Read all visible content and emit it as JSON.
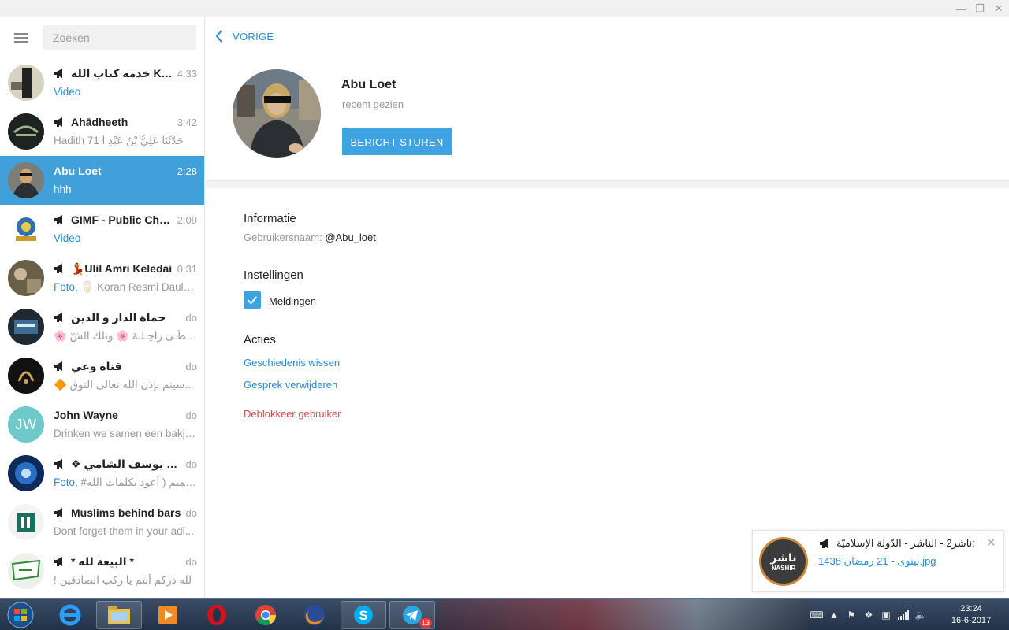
{
  "window": {
    "min": "—",
    "max": "❐",
    "close": "✕"
  },
  "sidebar": {
    "search_placeholder": "Zoeken",
    "chats": [
      {
        "name": "خدمة كتاب الله Koran...",
        "time": "4:33",
        "msg_prefix": "Video",
        "msg": "",
        "channel": true,
        "avatar": "koran"
      },
      {
        "name": "Ahādheeth",
        "time": "3:42",
        "msg_prefix": "",
        "msg": "Hadith 71 حَدَّثَنَا عَلِيُّ بْنُ عَبْدِ ا",
        "channel": true,
        "avatar": "ahadheeth"
      },
      {
        "name": "Abu Loet",
        "time": "2:28",
        "msg_prefix": "",
        "msg": "hhh",
        "channel": false,
        "avatar": "abuloet",
        "active": true
      },
      {
        "name": "GIMF - Public Chan...",
        "time": "2:09",
        "msg_prefix": "Video",
        "msg": "",
        "channel": true,
        "avatar": "gimf"
      },
      {
        "name": "💃Ulil Amri Keledai",
        "time": "0:31",
        "msg_prefix": "Foto,",
        "msg": " 🥛 Koran Resmi Daula...",
        "channel": true,
        "avatar": "ulil"
      },
      {
        "name": "حماة الدار و الدين",
        "time": "do",
        "msg_prefix": "",
        "msg": "🌸 خِـطّـى رَاحِـلـهٔ 🌸 وتلك الشّ...",
        "channel": true,
        "avatar": "himat"
      },
      {
        "name": "قناة وعي",
        "time": "do",
        "msg_prefix": "",
        "msg": "🔶 سيتم بإذن الله تعالى التوق...",
        "channel": true,
        "avatar": "waay"
      },
      {
        "name": "John Wayne",
        "time": "do",
        "msg_prefix": "",
        "msg": "Drinken we samen een bakje ...",
        "channel": false,
        "avatar": "jw",
        "initials": "JW"
      },
      {
        "name": "❖ أبو يوسف الشامي ❖",
        "time": "do",
        "msg_prefix": "Foto,",
        "msg": " #تصميم ( أعوذ بكلمات الله...",
        "channel": true,
        "avatar": "abuyusuf"
      },
      {
        "name": "Muslims behind bars",
        "time": "do",
        "msg_prefix": "",
        "msg": "Dont forget them in your adi...",
        "channel": true,
        "avatar": "muslims"
      },
      {
        "name": "* البيعة لله *",
        "time": "do",
        "msg_prefix": "",
        "msg": "! لله دركم أنتم يا ركب الصادقين",
        "channel": true,
        "avatar": "bayah"
      }
    ]
  },
  "main": {
    "back_label": "VORIGE",
    "profile": {
      "name": "Abu Loet",
      "status": "recent gezien",
      "send_button": "BERICHT STUREN"
    },
    "info": {
      "title": "Informatie",
      "username_label": "Gebruikersnaam:",
      "username_value": "@Abu_loet"
    },
    "settings": {
      "title": "Instellingen",
      "notifications_label": "Meldingen",
      "notifications_checked": true
    },
    "actions": {
      "title": "Acties",
      "clear_history": "Geschiedenis wissen",
      "delete_chat": "Gesprek verwijderen",
      "unblock_user": "Deblokkeer gebruiker"
    }
  },
  "notification": {
    "title": "ناشر2 - الناشر - الدّولة الإسلاميّة:",
    "body": "نينوى - 21 رمضان 1438.jpg",
    "avatar_text_ar": "ناشر",
    "avatar_text_en": "NASHIR",
    "close": "✕"
  },
  "taskbar": {
    "telegram_badge": "13",
    "time": "23:24",
    "date": "16-6-2017"
  },
  "colors": {
    "accent": "#419fd9",
    "link": "#2a8ad4",
    "danger": "#d14b4b"
  }
}
